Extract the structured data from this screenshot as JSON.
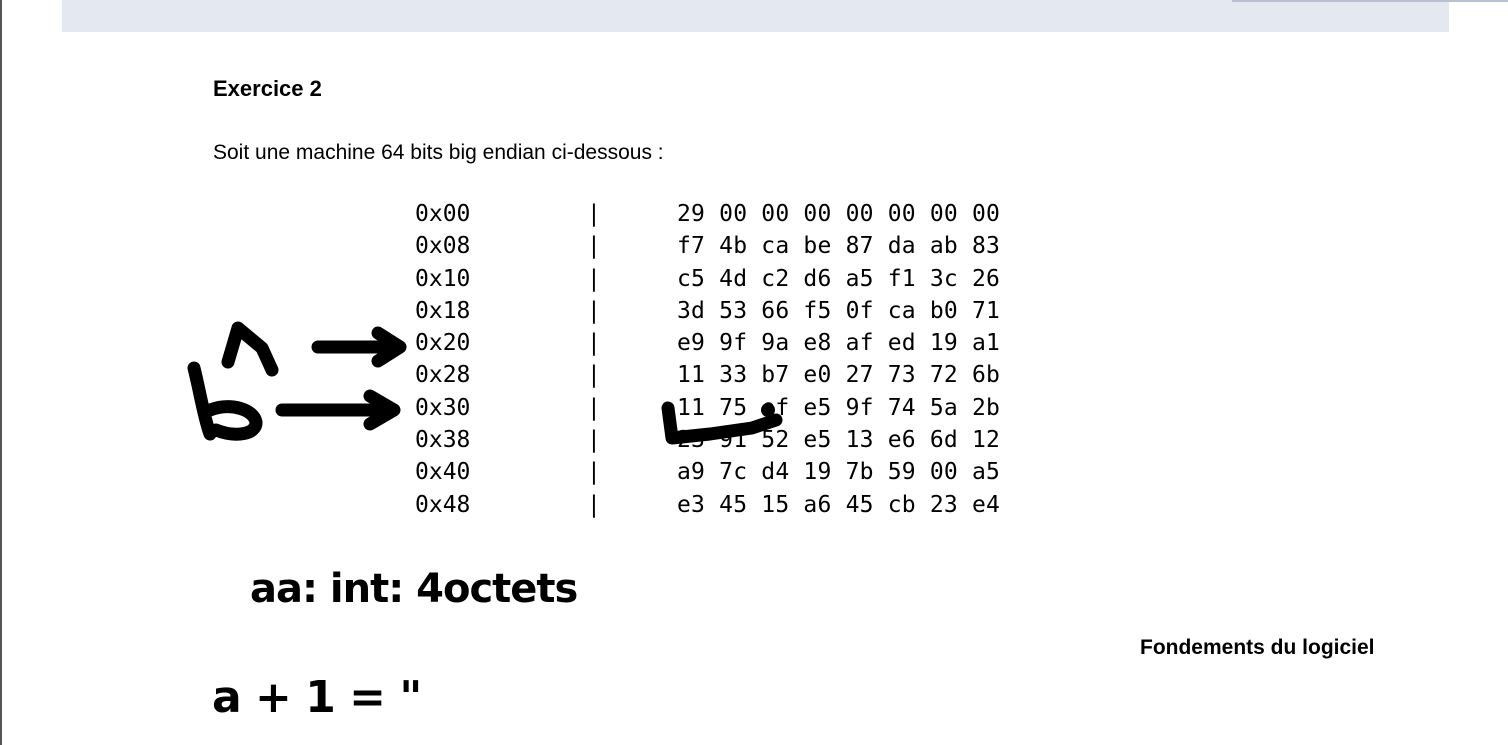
{
  "document": {
    "title": "Exercice 2",
    "intro": "Soit une machine 64 bits big endian ci-dessous :",
    "footer": "Fondements du logiciel"
  },
  "memory_dump": {
    "separator": "|",
    "rows": [
      {
        "address": "0x00",
        "bytes": "29 00 00 00 00 00 00 00"
      },
      {
        "address": "0x08",
        "bytes": "f7 4b ca be 87 da ab 83"
      },
      {
        "address": "0x10",
        "bytes": "c5 4d c2 d6 a5 f1 3c 26"
      },
      {
        "address": "0x18",
        "bytes": "3d 53 66 f5 0f ca b0 71"
      },
      {
        "address": "0x20",
        "bytes": "e9 9f 9a e8 af ed 19 a1"
      },
      {
        "address": "0x28",
        "bytes": "11 33 b7 e0 27 73 72 6b"
      },
      {
        "address": "0x30",
        "bytes": "11 75 ef e5 9f 74 5a 2b"
      },
      {
        "address": "0x38",
        "bytes": "23 91 52 e5 13 e6 6d 12"
      },
      {
        "address": "0x40",
        "bytes": "a9 7c d4 19 7b 59 00 a5"
      },
      {
        "address": "0x48",
        "bytes": "e3 45 15 a6 45 cb 23 e4"
      }
    ]
  },
  "annotations": {
    "note_1": "aa: int: 4octets",
    "note_2": "a + 1 = \"",
    "ink_color": "#000000"
  }
}
